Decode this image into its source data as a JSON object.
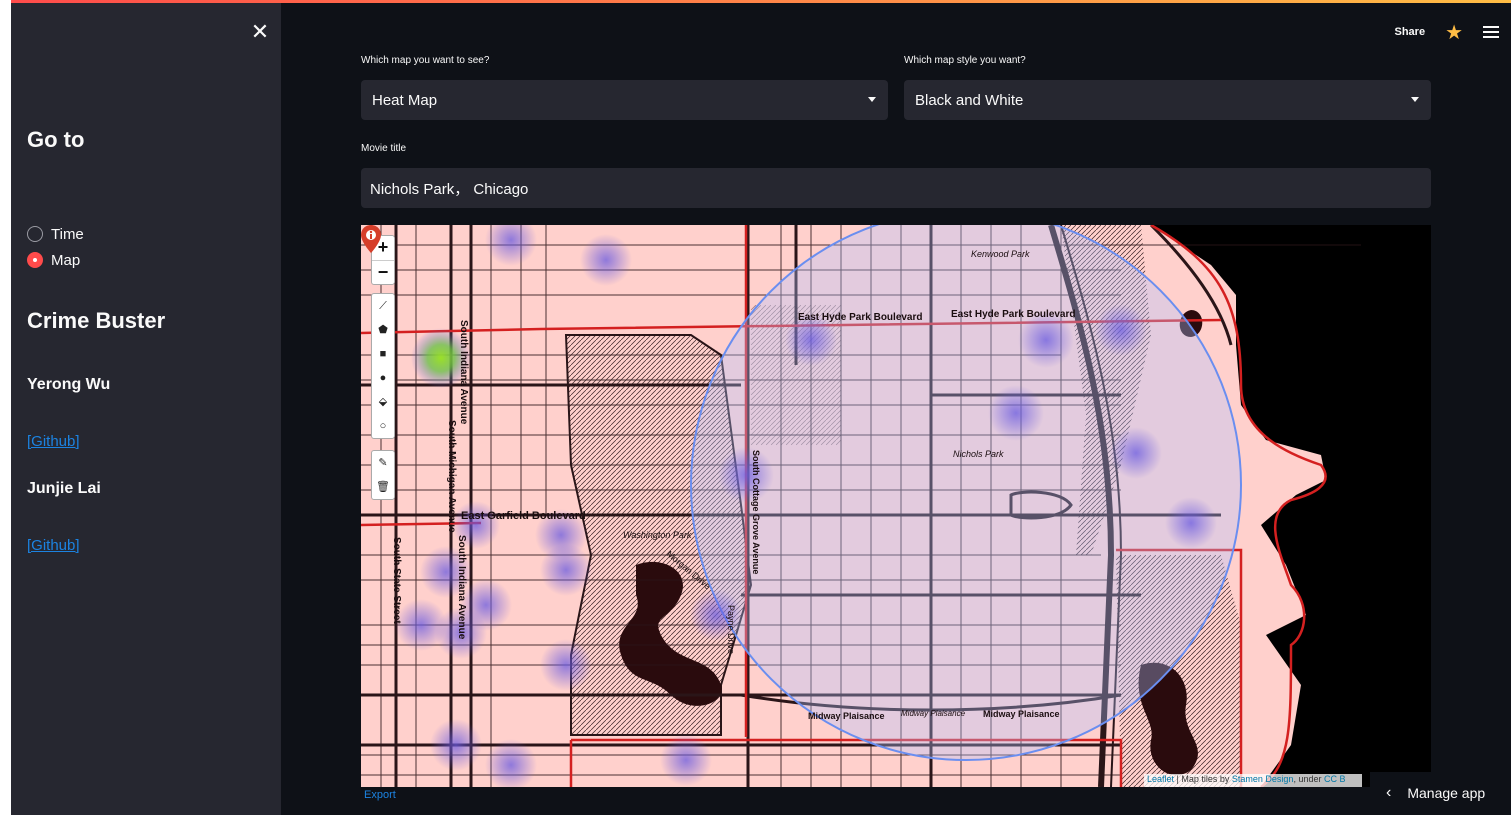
{
  "sidebar": {
    "close_icon": "close-icon",
    "goto_title": "Go to",
    "radio_options": [
      {
        "label": "Time",
        "selected": false
      },
      {
        "label": "Map",
        "selected": true
      }
    ],
    "app_title": "Crime Buster",
    "authors": [
      {
        "name": "Yerong Wu",
        "link": "[Github]"
      },
      {
        "name": "Junjie Lai",
        "link": "[Github]"
      }
    ]
  },
  "header": {
    "share_label": "Share",
    "star_icon": "star-icon",
    "menu_icon": "hamburger-menu-icon"
  },
  "controls": {
    "map_select_label": "Which map you want to see?",
    "map_select_value": "Heat Map",
    "style_select_label": "Which map style you want?",
    "style_select_value": "Black and White",
    "text_input_label": "Movie title",
    "text_input_value": "Nichols Park， Chicago"
  },
  "map": {
    "zoom_in": "+",
    "zoom_out": "−",
    "streets": {
      "east_hyde_1": "East Hyde Park Boulevard",
      "east_hyde_2": "East Hyde Park Boulevard",
      "kenwood": "Kenwood Park",
      "nichols": "Nichols Park",
      "garfield": "East Garfield Boulevard",
      "washington": "Washington Park",
      "morgan": "Morgan Drive",
      "cottage": "South Cottage Grove Avenue",
      "indiana": "South Indiana Avenue",
      "michigan": "South Michigan Avenue",
      "indiana2": "South Indiana Avenue",
      "state": "South State Street",
      "payne": "Payne Drive",
      "midway": "Midway Plaisance",
      "midway2": "Midway Plaisance",
      "midway3": "Midway Plaisance"
    },
    "attribution_leaflet": "Leaflet",
    "attribution_mid": " | Map tiles by ",
    "attribution_stamen": "Stamen Design",
    "attribution_under": ", under ",
    "attribution_cc": "CC B",
    "export_label": "Export",
    "marker_icon": "map-marker-icon",
    "colors": {
      "fill": "#ffd0cc",
      "roads": "#2a1518",
      "boundary": "#d42020",
      "circle": "#6a8ef0",
      "water": "#000000"
    }
  },
  "footer": {
    "manage_label": "Manage app"
  }
}
